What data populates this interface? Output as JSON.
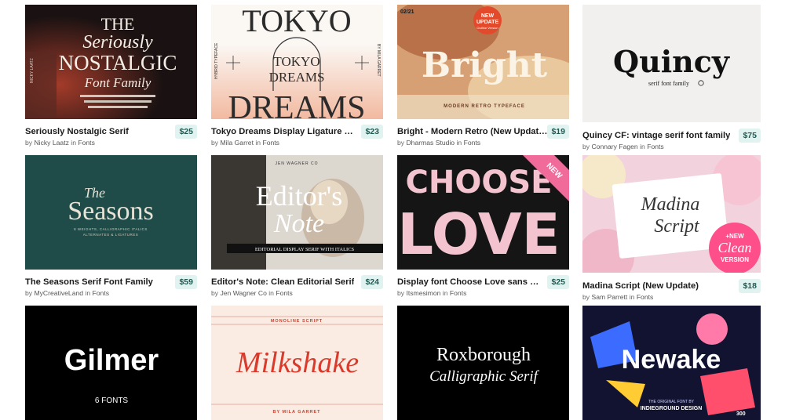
{
  "cards": [
    {
      "title": "Seriously Nostalgic Serif",
      "price": "$25",
      "author": "Nicky Laatz",
      "in_word": "in",
      "by_word": "by",
      "category": "Fonts",
      "art": {
        "line1": "THE",
        "line2": "Seriously",
        "line3": "NOSTALGIC",
        "line4": "Font Family",
        "side": "NICKY LAATZ"
      }
    },
    {
      "title": "Tokyo Dreams Display Ligature Serif",
      "price": "$23",
      "author": "Mila Garret",
      "in_word": "in",
      "by_word": "by",
      "category": "Fonts",
      "art": {
        "top": "TOKYO",
        "mid1": "TOKYO",
        "mid2": "DREAMS",
        "bottom": "DREAMS",
        "left": "HYBRID TYPEFACE",
        "right": "BY MILA GARRET"
      }
    },
    {
      "title": "Bright - Modern Retro (New Update!)",
      "price": "$19",
      "author": "Dharmas Studio",
      "in_word": "in",
      "by_word": "by",
      "category": "Fonts",
      "art": {
        "word": "Bright",
        "badge1": "NEW",
        "badge2": "UPDATE",
        "badge3": "Outline Version",
        "tag": "MODERN RETRO TYPEFACE",
        "num": "02/21"
      }
    },
    {
      "title": "Quincy CF: vintage serif font family",
      "price": "$75",
      "author": "Connary Fagen",
      "in_word": "in",
      "by_word": "by",
      "category": "Fonts",
      "art": {
        "word": "Quincy",
        "sub": "serif font family"
      }
    },
    {
      "title": "The Seasons Serif Font Family",
      "price": "$59",
      "author": "MyCreativeLand",
      "in_word": "in",
      "by_word": "by",
      "category": "Fonts",
      "art": {
        "the": "The",
        "word": "Seasons",
        "sub1": "8 WEIGHTS, CALLIGRAPHIC ITALICS",
        "sub2": "ALTERNATES & LIGATURES"
      }
    },
    {
      "title": "Editor's Note: Clean Editorial Serif",
      "price": "$24",
      "author": "Jen Wagner Co",
      "in_word": "in",
      "by_word": "by",
      "category": "Fonts",
      "art": {
        "top": "JEN WAGNER CO",
        "w1": "Editor's",
        "w2": "Note",
        "bar": "EDITORIAL DISPLAY SERIF WITH ITALICS"
      }
    },
    {
      "title": "Display font Choose Love sans serif",
      "price": "$25",
      "author": "Itsmesimon",
      "in_word": "in",
      "by_word": "by",
      "category": "Fonts",
      "art": {
        "w1": "CHOOSE",
        "w2": "LOVE",
        "ribbon": "NEW"
      }
    },
    {
      "title": "Madina Script (New Update)",
      "price": "$18",
      "author": "Sam Parrett",
      "in_word": "in",
      "by_word": "by",
      "category": "Fonts",
      "art": {
        "w1": "Madina",
        "w2": "Script",
        "b1": "+NEW",
        "b2": "Clean",
        "b3": "VERSION"
      }
    },
    {
      "title": "",
      "price": "",
      "author": "",
      "in_word": "",
      "by_word": "",
      "category": "",
      "art": {
        "word": "Gilmer",
        "sub": "6 FONTS"
      }
    },
    {
      "title": "",
      "price": "",
      "author": "",
      "in_word": "",
      "by_word": "",
      "category": "",
      "art": {
        "top": "MONOLINE SCRIPT",
        "word": "Milkshake",
        "bottom": "BY MILA GARRET"
      }
    },
    {
      "title": "",
      "price": "",
      "author": "",
      "in_word": "",
      "by_word": "",
      "category": "",
      "art": {
        "w1": "Roxborough",
        "w2": "Calligraphic Serif"
      }
    },
    {
      "title": "",
      "price": "",
      "author": "",
      "in_word": "",
      "by_word": "",
      "category": "",
      "art": {
        "word": "Newake",
        "sub1": "THE ORIGINAL FONT BY",
        "sub2": "INDIEGROUND DESIGN",
        "num": "300"
      }
    }
  ]
}
